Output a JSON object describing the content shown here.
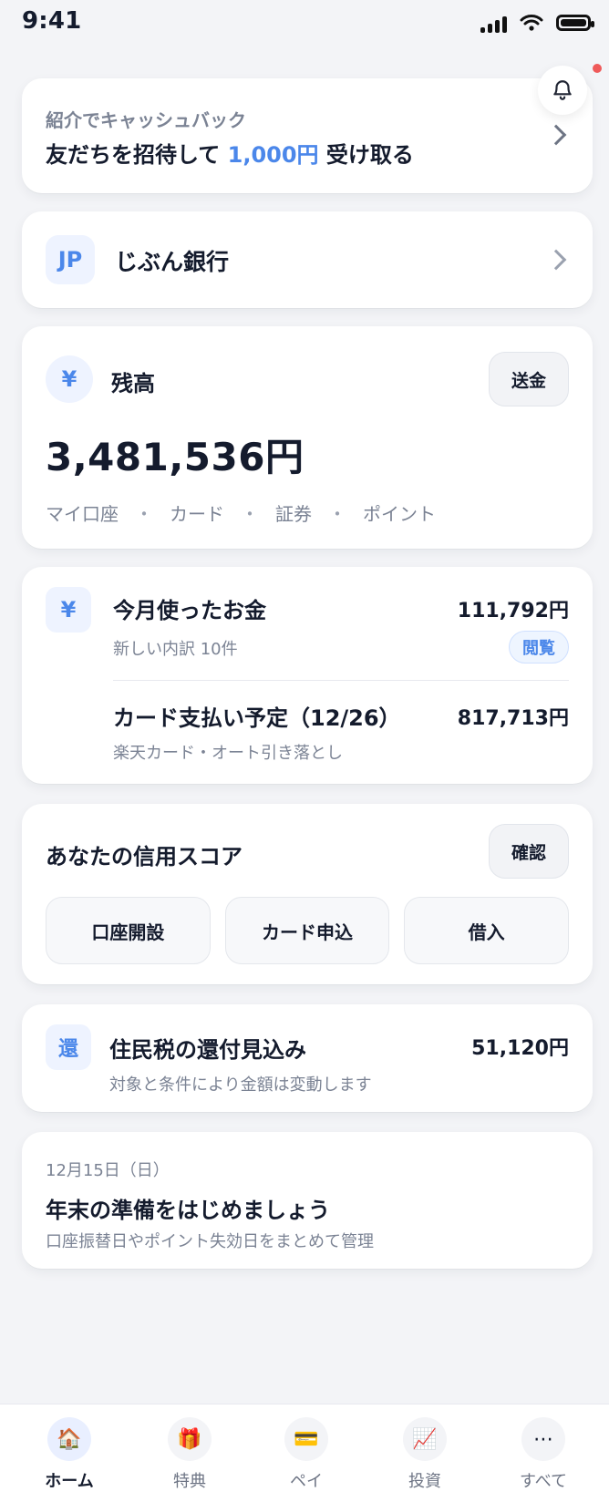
{
  "status": {
    "time": "9:41"
  },
  "referral": {
    "subtitle": "紹介でキャッシュバック",
    "title_prefix": "友だちを招待して",
    "amount": "1,000円",
    "title_suffix": "受け取る"
  },
  "bank": {
    "logo": "JP",
    "name": "じぶん銀行"
  },
  "balance": {
    "icon_text": "¥",
    "label": "残高",
    "button": "送金",
    "amount": "3,481,536円",
    "tags": [
      "マイ口座",
      "カード",
      "証券",
      "ポイント"
    ],
    "tag_separator": "・"
  },
  "spending": {
    "icon_text": "¥",
    "title": "今月使ったお金",
    "subtitle": "新しい内訳 10件",
    "value": "111,792円",
    "badge": "閲覧",
    "card_title": "カード支払い予定（12/26）",
    "card_subtitle": "楽天カード・オート引き落とし",
    "card_value": "817,713円"
  },
  "credit": {
    "title": "あなたの信用スコア",
    "button": "確認",
    "actions": [
      "口座開設",
      "カード申込",
      "借入"
    ]
  },
  "tax": {
    "icon_text": "還",
    "title": "住民税の還付見込み",
    "subtitle": "対象と条件により金額は変動します",
    "value": "51,120円"
  },
  "reminder": {
    "date": "12月15日（日）",
    "title": "年末の準備をはじめましょう",
    "subtitle": "口座振替日やポイント失効日をまとめて管理"
  },
  "tabs": [
    {
      "label": "ホーム",
      "icon": "🏠",
      "active": true
    },
    {
      "label": "特典",
      "icon": "🎁",
      "active": false
    },
    {
      "label": "ペイ",
      "icon": "💳",
      "active": false
    },
    {
      "label": "投資",
      "icon": "📈",
      "active": false
    },
    {
      "label": "すべて",
      "icon": "⋯",
      "active": false
    }
  ],
  "colors": {
    "accent": "#4b87ea",
    "notification_dot": "#ef5a5a",
    "background": "#f3f4f7"
  }
}
